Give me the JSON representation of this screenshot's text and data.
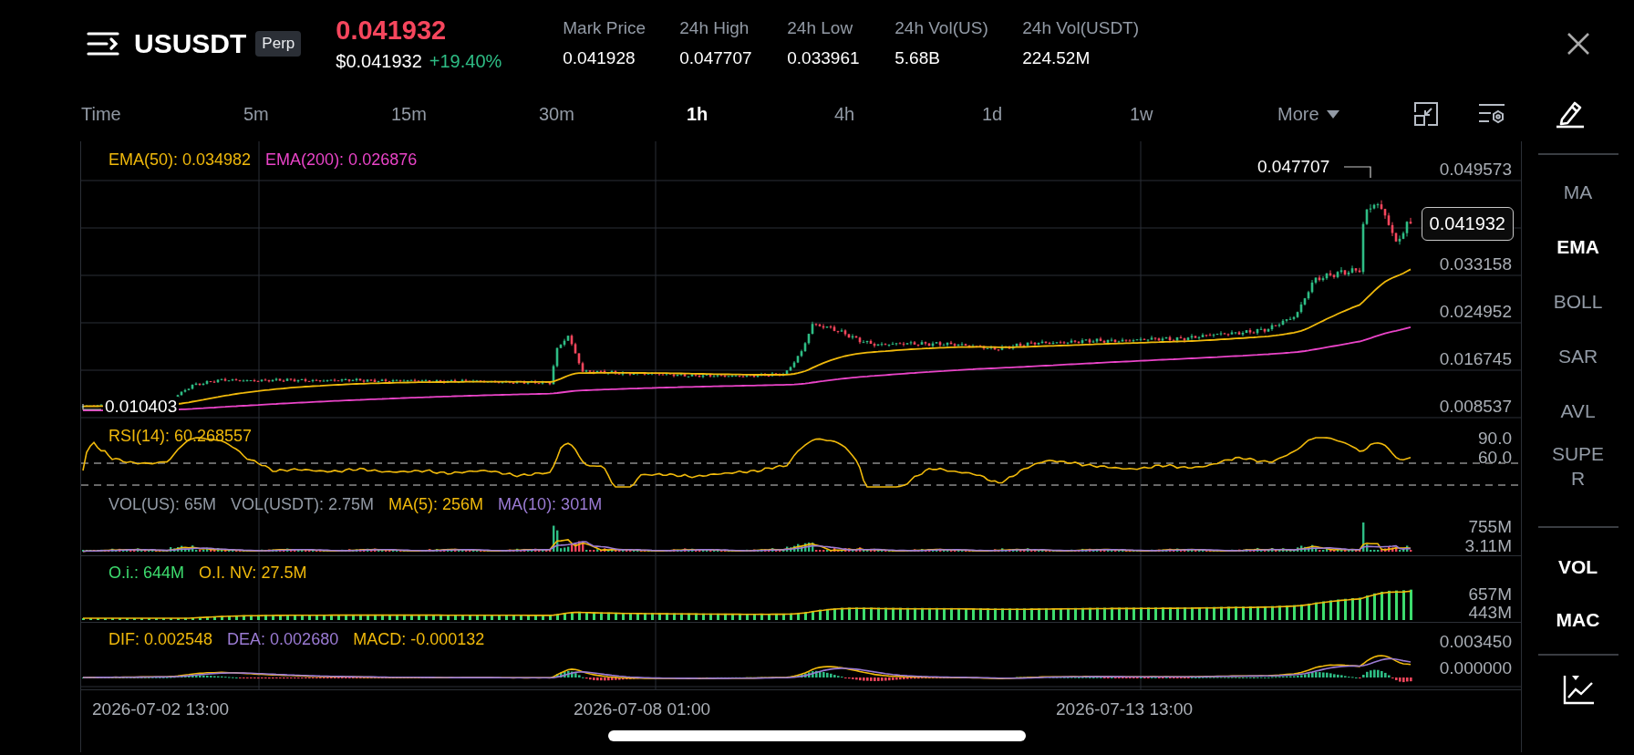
{
  "header": {
    "symbol": "USUSDT",
    "badge": "Perp",
    "last_price": "0.041932",
    "usd_price": "$0.041932",
    "change": "+19.40%",
    "stats": [
      {
        "label": "Mark Price",
        "value": "0.041928"
      },
      {
        "label": "24h High",
        "value": "0.047707"
      },
      {
        "label": "24h Low",
        "value": "0.033961"
      },
      {
        "label": "24h Vol(US)",
        "value": "5.68B"
      },
      {
        "label": "24h Vol(USDT)",
        "value": "224.52M"
      }
    ]
  },
  "timeframes": {
    "label": "Time",
    "intervals": [
      {
        "label": "5m",
        "selected": false
      },
      {
        "label": "15m",
        "selected": false
      },
      {
        "label": "30m",
        "selected": false
      },
      {
        "label": "1h",
        "selected": true
      },
      {
        "label": "4h",
        "selected": false
      },
      {
        "label": "1d",
        "selected": false
      },
      {
        "label": "1w",
        "selected": false
      }
    ],
    "more": "More"
  },
  "panes": [
    {
      "kind": "price",
      "legend": [
        {
          "text": "EMA(50): 0.034982",
          "color": "#f0b90b"
        },
        {
          "text": "EMA(200): 0.026876",
          "color": "#ea44c8"
        }
      ],
      "axis": [
        "0.049573",
        "0.033158",
        "0.024952",
        "0.016745",
        "0.008537"
      ],
      "high_label": "0.047707",
      "low_label": "0.010403",
      "price_tag": "0.041932"
    },
    {
      "kind": "rsi",
      "legend": [
        {
          "text": "RSI(14): 60.268557",
          "color": "#f0b90b"
        }
      ],
      "axis": [
        "90.0",
        "60.0"
      ]
    },
    {
      "kind": "volume",
      "legend": [
        {
          "text": "VOL(US): 65M",
          "color": "#929aa5"
        },
        {
          "text": "VOL(USDT): 2.75M",
          "color": "#929aa5"
        },
        {
          "text": "MA(5): 256M",
          "color": "#f0b90b"
        },
        {
          "text": "MA(10): 301M",
          "color": "#9b7bd4"
        }
      ],
      "axis": [
        "755M",
        "3.11M"
      ]
    },
    {
      "kind": "oi",
      "legend": [
        {
          "text": "O.i.: 644M",
          "color": "#3ddc6e"
        },
        {
          "text": "O.I. NV: 27.5M",
          "color": "#f0b90b"
        }
      ],
      "axis": [
        "657M",
        "443M"
      ]
    },
    {
      "kind": "macd",
      "legend": [
        {
          "text": "DIF: 0.002548",
          "color": "#f0b90b"
        },
        {
          "text": "DEA: 0.002680",
          "color": "#9b7bd4"
        },
        {
          "text": "MACD: -0.000132",
          "color": "#f0b90b"
        }
      ],
      "axis": [
        "0.003450",
        "0.000000"
      ]
    }
  ],
  "time_axis": [
    "2026-07-02 13:00",
    "2026-07-08 01:00",
    "2026-07-13 13:00"
  ],
  "sidebar": {
    "main_indicators": [
      {
        "label": "MA",
        "selected": false
      },
      {
        "label": "EMA",
        "selected": true
      },
      {
        "label": "BOLL",
        "selected": false
      },
      {
        "label": "SAR",
        "selected": false
      },
      {
        "label": "AVL",
        "selected": false
      },
      {
        "label": "SUPER",
        "selected": false
      }
    ],
    "sub_indicators": [
      {
        "label": "VOL",
        "selected": true
      },
      {
        "label": "MAC",
        "selected": true
      }
    ]
  }
}
